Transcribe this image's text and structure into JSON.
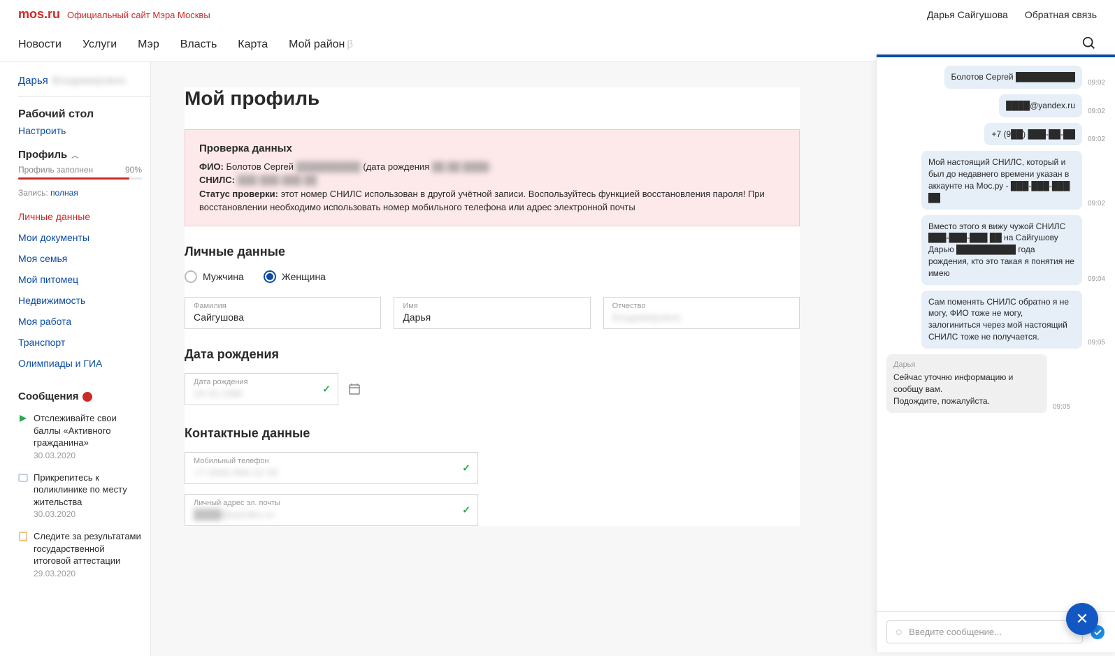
{
  "brand": {
    "logo": "mos.ru",
    "tagline": "Официальный сайт Мэра Москвы"
  },
  "topRight": {
    "user": "Дарья Сайгушова",
    "feedback": "Обратная связь"
  },
  "nav": {
    "news": "Новости",
    "services": "Услуги",
    "mayor": "Мэр",
    "authority": "Власть",
    "map": "Карта",
    "district": "Мой район",
    "beta": "β"
  },
  "sidebar": {
    "userFirst": "Дарья",
    "userLastBlur": "Владимировна",
    "desk": {
      "title": "Рабочий стол",
      "configure": "Настроить"
    },
    "profile": {
      "title": "Профиль",
      "progLabel": "Профиль заполнен",
      "progPct": "90%",
      "recLabel": "Запись:",
      "recVal": "полная"
    },
    "items": [
      "Личные данные",
      "Мои документы",
      "Моя семья",
      "Мой питомец",
      "Недвижимость",
      "Моя работа",
      "Транспорт",
      "Олимпиады и ГИА"
    ],
    "messages": {
      "title": "Сообщения",
      "list": [
        {
          "title": "Отслеживайте свои баллы «Активного гражданина»",
          "date": "30.03.2020",
          "color": "#2aa84f"
        },
        {
          "title": "Прикрепитесь к поликлинике по месту жительства",
          "date": "30.03.2020",
          "color": "#9ab6d8"
        },
        {
          "title": "Следите за результатами государственной итоговой аттестации",
          "date": "29.03.2020",
          "color": "#e6a24a"
        }
      ]
    }
  },
  "page": {
    "h1": "Мой профиль",
    "alert": {
      "title": "Проверка данных",
      "fioLabel": "ФИО:",
      "fioVal": "Болотов Сергей",
      "fioBlur": "██████████",
      "dobPrefix": "(дата рождения",
      "dobBlur": "██.██.████)",
      "snilsLabel": "СНИЛС:",
      "snilsBlur": "███-███-███ ██",
      "statusLabel": "Статус проверки:",
      "statusText": "этот номер СНИЛС использован в другой учётной записи. Воспользуйтесь функцией восстановления пароля! При восстановлении необходимо использовать номер мобильного телефона или адрес электронной почты"
    },
    "personal": {
      "h": "Личные данные",
      "male": "Мужчина",
      "female": "Женщина",
      "lnameLabel": "Фамилия",
      "lname": "Сайгушова",
      "fnameLabel": "Имя",
      "fname": "Дарья",
      "mnameLabel": "Отчество",
      "mnameBlur": "Владимировна"
    },
    "dob": {
      "h": "Дата рождения",
      "label": "Дата рождения",
      "valBlur": "29.04.1986"
    },
    "contact": {
      "h": "Контактные данные",
      "phoneLabel": "Мобильный телефон",
      "phoneBlur": "+7 (999) 866-22-38",
      "emailLabel": "Личный адрес эл. почты",
      "emailBlur": "████@yandex.ru"
    }
  },
  "chat": {
    "msgs": [
      {
        "side": "right",
        "text": "Болотов Сергей ██████████",
        "time": "09:02"
      },
      {
        "side": "right",
        "text": "████@yandex.ru",
        "time": "09:02"
      },
      {
        "side": "right",
        "text": "+7 (9██) ███-██-██",
        "time": "09:02"
      },
      {
        "side": "right",
        "text": "Мой настоящий СНИЛС, который и был до недавнего времени указан в аккаунте на Мос.ру - ███-███-███ ██",
        "time": "09:02"
      },
      {
        "side": "right",
        "text": "Вместо этого я вижу чужой СНИЛС ███-███-███ ██ на Сайгушову Дарью ██████████ года рождения, кто это такая я понятия не имею",
        "time": "09:04"
      },
      {
        "side": "right",
        "text": "Сам поменять СНИЛС обратно я не могу, ФИО тоже не могу, залогиниться через мой настоящий СНИЛС тоже не получается.",
        "time": "09:05"
      },
      {
        "side": "left",
        "author": "Дарья",
        "text": "Сейчас уточню информацию и сообщу вам.\nПодождите, пожалуйста.",
        "time": "09:05"
      }
    ],
    "placeholder": "Введите сообщение..."
  }
}
